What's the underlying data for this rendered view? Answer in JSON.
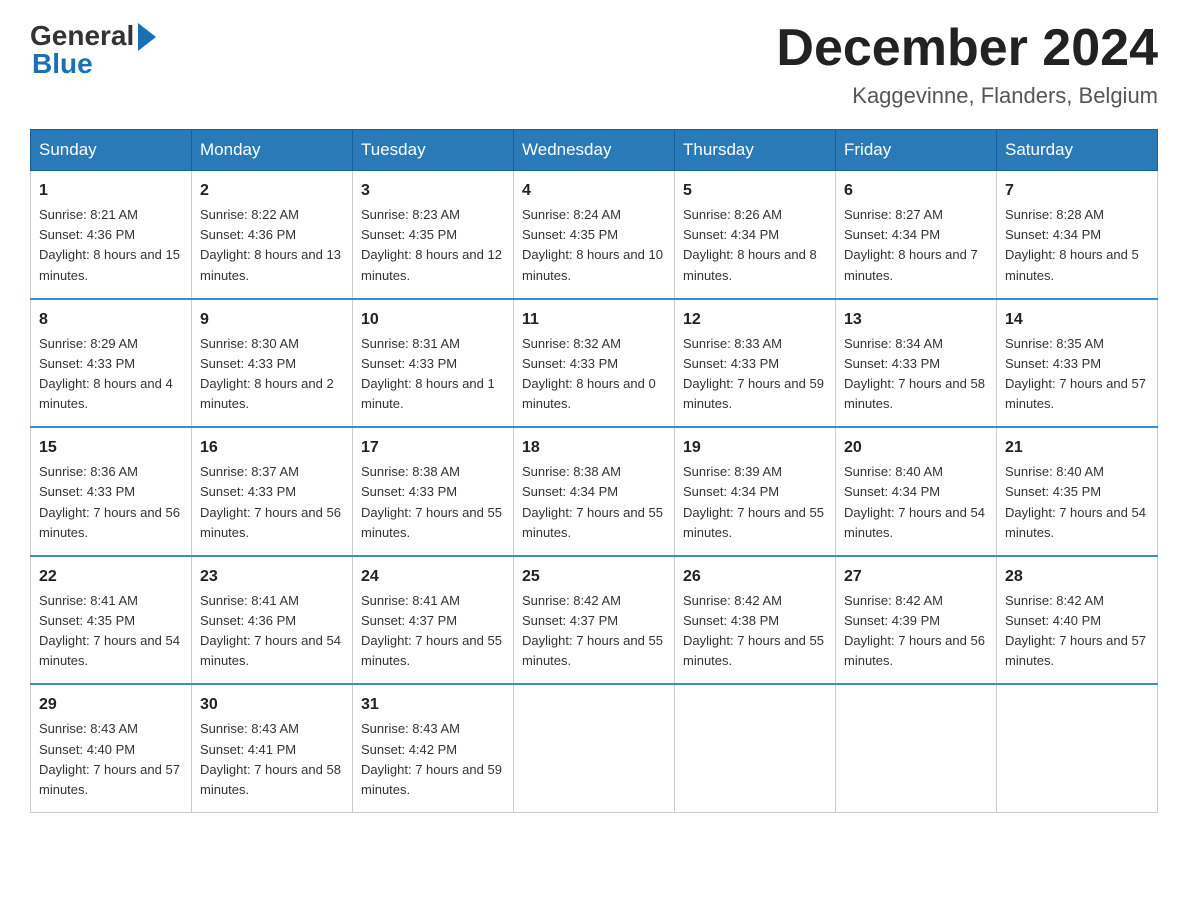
{
  "header": {
    "logo_general": "General",
    "logo_blue": "Blue",
    "month_title": "December 2024",
    "location": "Kaggevinne, Flanders, Belgium"
  },
  "weekdays": [
    "Sunday",
    "Monday",
    "Tuesday",
    "Wednesday",
    "Thursday",
    "Friday",
    "Saturday"
  ],
  "weeks": [
    [
      {
        "day": "1",
        "sunrise": "8:21 AM",
        "sunset": "4:36 PM",
        "daylight": "8 hours and 15 minutes."
      },
      {
        "day": "2",
        "sunrise": "8:22 AM",
        "sunset": "4:36 PM",
        "daylight": "8 hours and 13 minutes."
      },
      {
        "day": "3",
        "sunrise": "8:23 AM",
        "sunset": "4:35 PM",
        "daylight": "8 hours and 12 minutes."
      },
      {
        "day": "4",
        "sunrise": "8:24 AM",
        "sunset": "4:35 PM",
        "daylight": "8 hours and 10 minutes."
      },
      {
        "day": "5",
        "sunrise": "8:26 AM",
        "sunset": "4:34 PM",
        "daylight": "8 hours and 8 minutes."
      },
      {
        "day": "6",
        "sunrise": "8:27 AM",
        "sunset": "4:34 PM",
        "daylight": "8 hours and 7 minutes."
      },
      {
        "day": "7",
        "sunrise": "8:28 AM",
        "sunset": "4:34 PM",
        "daylight": "8 hours and 5 minutes."
      }
    ],
    [
      {
        "day": "8",
        "sunrise": "8:29 AM",
        "sunset": "4:33 PM",
        "daylight": "8 hours and 4 minutes."
      },
      {
        "day": "9",
        "sunrise": "8:30 AM",
        "sunset": "4:33 PM",
        "daylight": "8 hours and 2 minutes."
      },
      {
        "day": "10",
        "sunrise": "8:31 AM",
        "sunset": "4:33 PM",
        "daylight": "8 hours and 1 minute."
      },
      {
        "day": "11",
        "sunrise": "8:32 AM",
        "sunset": "4:33 PM",
        "daylight": "8 hours and 0 minutes."
      },
      {
        "day": "12",
        "sunrise": "8:33 AM",
        "sunset": "4:33 PM",
        "daylight": "7 hours and 59 minutes."
      },
      {
        "day": "13",
        "sunrise": "8:34 AM",
        "sunset": "4:33 PM",
        "daylight": "7 hours and 58 minutes."
      },
      {
        "day": "14",
        "sunrise": "8:35 AM",
        "sunset": "4:33 PM",
        "daylight": "7 hours and 57 minutes."
      }
    ],
    [
      {
        "day": "15",
        "sunrise": "8:36 AM",
        "sunset": "4:33 PM",
        "daylight": "7 hours and 56 minutes."
      },
      {
        "day": "16",
        "sunrise": "8:37 AM",
        "sunset": "4:33 PM",
        "daylight": "7 hours and 56 minutes."
      },
      {
        "day": "17",
        "sunrise": "8:38 AM",
        "sunset": "4:33 PM",
        "daylight": "7 hours and 55 minutes."
      },
      {
        "day": "18",
        "sunrise": "8:38 AM",
        "sunset": "4:34 PM",
        "daylight": "7 hours and 55 minutes."
      },
      {
        "day": "19",
        "sunrise": "8:39 AM",
        "sunset": "4:34 PM",
        "daylight": "7 hours and 55 minutes."
      },
      {
        "day": "20",
        "sunrise": "8:40 AM",
        "sunset": "4:34 PM",
        "daylight": "7 hours and 54 minutes."
      },
      {
        "day": "21",
        "sunrise": "8:40 AM",
        "sunset": "4:35 PM",
        "daylight": "7 hours and 54 minutes."
      }
    ],
    [
      {
        "day": "22",
        "sunrise": "8:41 AM",
        "sunset": "4:35 PM",
        "daylight": "7 hours and 54 minutes."
      },
      {
        "day": "23",
        "sunrise": "8:41 AM",
        "sunset": "4:36 PM",
        "daylight": "7 hours and 54 minutes."
      },
      {
        "day": "24",
        "sunrise": "8:41 AM",
        "sunset": "4:37 PM",
        "daylight": "7 hours and 55 minutes."
      },
      {
        "day": "25",
        "sunrise": "8:42 AM",
        "sunset": "4:37 PM",
        "daylight": "7 hours and 55 minutes."
      },
      {
        "day": "26",
        "sunrise": "8:42 AM",
        "sunset": "4:38 PM",
        "daylight": "7 hours and 55 minutes."
      },
      {
        "day": "27",
        "sunrise": "8:42 AM",
        "sunset": "4:39 PM",
        "daylight": "7 hours and 56 minutes."
      },
      {
        "day": "28",
        "sunrise": "8:42 AM",
        "sunset": "4:40 PM",
        "daylight": "7 hours and 57 minutes."
      }
    ],
    [
      {
        "day": "29",
        "sunrise": "8:43 AM",
        "sunset": "4:40 PM",
        "daylight": "7 hours and 57 minutes."
      },
      {
        "day": "30",
        "sunrise": "8:43 AM",
        "sunset": "4:41 PM",
        "daylight": "7 hours and 58 minutes."
      },
      {
        "day": "31",
        "sunrise": "8:43 AM",
        "sunset": "4:42 PM",
        "daylight": "7 hours and 59 minutes."
      },
      null,
      null,
      null,
      null
    ]
  ]
}
